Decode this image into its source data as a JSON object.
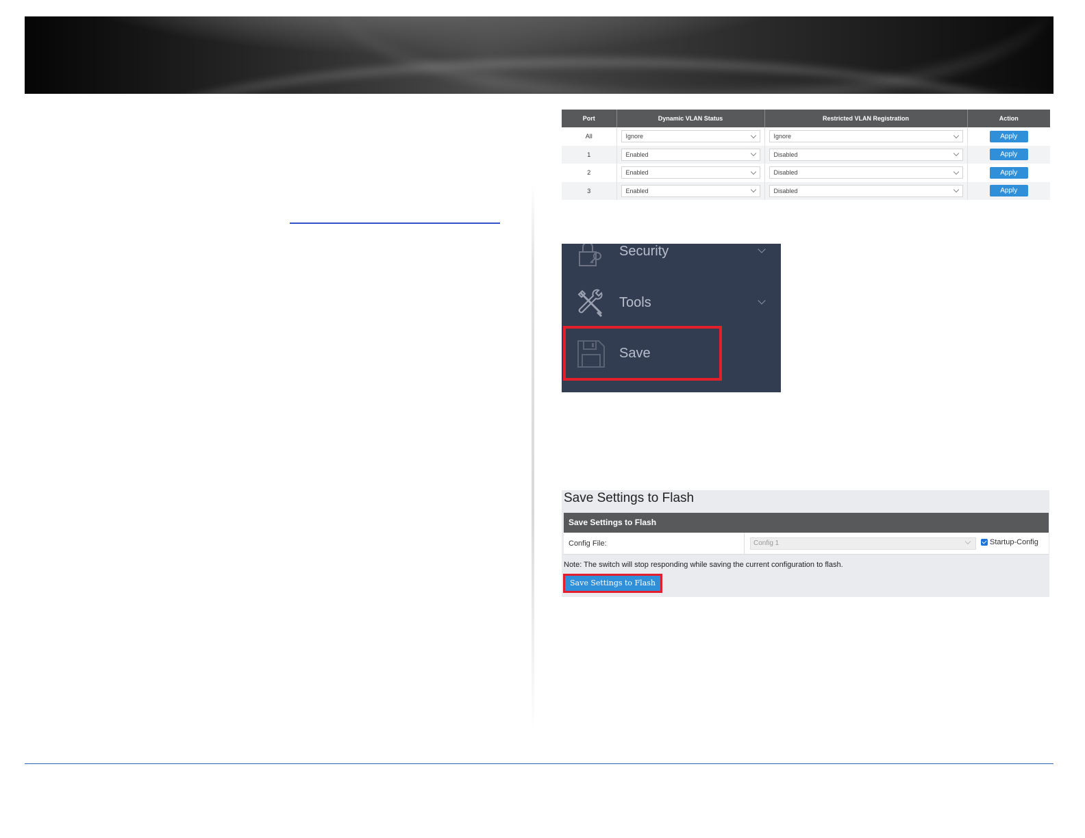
{
  "vlan_table": {
    "headers": [
      "Port",
      "Dynamic VLAN Status",
      "Restricted VLAN Registration",
      "Action"
    ],
    "rows": [
      {
        "port": "All",
        "dynamic": "Ignore",
        "restricted": "Ignore",
        "action": "Apply"
      },
      {
        "port": "1",
        "dynamic": "Enabled",
        "restricted": "Disabled",
        "action": "Apply"
      },
      {
        "port": "2",
        "dynamic": "Enabled",
        "restricted": "Disabled",
        "action": "Apply"
      },
      {
        "port": "3",
        "dynamic": "Enabled",
        "restricted": "Disabled",
        "action": "Apply"
      }
    ]
  },
  "menu": {
    "items": [
      {
        "label": "Security",
        "icon": "lock-icon"
      },
      {
        "label": "Tools",
        "icon": "tools-icon"
      },
      {
        "label": "Save",
        "icon": "floppy-disk-icon"
      }
    ]
  },
  "save_settings": {
    "page_title": "Save Settings to Flash",
    "section_header": "Save Settings to Flash",
    "config_file_label": "Config File:",
    "config_file_value": "Config 1",
    "startup_config_label": "Startup-Config",
    "startup_config_checked": true,
    "note": "Note: The switch will stop responding while saving the current configuration to flash.",
    "button_label": "Save Settings to Flash"
  },
  "colors": {
    "table_header": "#58595b",
    "button_blue": "#2f8fd8",
    "highlight_red": "#e2202c",
    "menu_background": "#333d52",
    "rule_blue": "#2a66b8"
  }
}
